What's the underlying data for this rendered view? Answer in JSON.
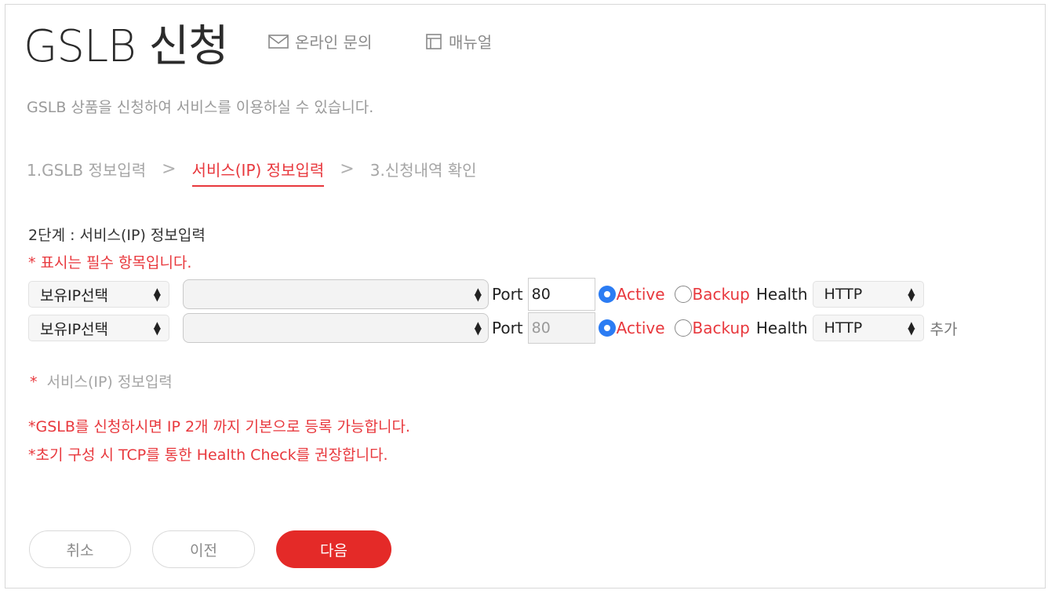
{
  "header": {
    "title": "GSLB 신청",
    "links": [
      {
        "label": "온라인 문의",
        "icon": "mail-icon"
      },
      {
        "label": "매뉴얼",
        "icon": "manual-icon"
      }
    ]
  },
  "description": "GSLB 상품을 신청하여 서비스를 이용하실 수 있습니다.",
  "steps": [
    {
      "label": "1.GSLB 정보입력",
      "active": false
    },
    {
      "label": "서비스(IP) 정보입력",
      "active": true
    },
    {
      "label": "3.신청내역 확인",
      "active": false
    }
  ],
  "step_separator": ">",
  "form": {
    "section_title": "2단계 : 서비스(IP) 정보입력",
    "required_note": "* 표시는 필수 항목입니다.",
    "rows": [
      {
        "ip_type": "보유IP선택",
        "ip_value": "",
        "port_label": "Port",
        "port": "80",
        "port_disabled": false,
        "active_label": "Active",
        "backup_label": "Backup",
        "selected": "Active",
        "health_label": "Health",
        "health": "HTTP",
        "add_label": ""
      },
      {
        "ip_type": "보유IP선택",
        "ip_value": "",
        "port_label": "Port",
        "port": "80",
        "port_disabled": true,
        "active_label": "Active",
        "backup_label": "Backup",
        "selected": "Active",
        "health_label": "Health",
        "health": "HTTP",
        "add_label": "추가"
      }
    ],
    "service_label_star": "*",
    "service_label": "서비스(IP) 정보입력",
    "notes": [
      "*GSLB를 신청하시면 IP 2개 까지 기본으로 등록 가능합니다.",
      "*초기 구성 시 TCP를 통한 Health Check를 권장합니다."
    ]
  },
  "buttons": {
    "cancel": "취소",
    "prev": "이전",
    "next": "다음"
  },
  "colors": {
    "accent": "#e42a28",
    "radio_selected": "#2b7cf3"
  }
}
